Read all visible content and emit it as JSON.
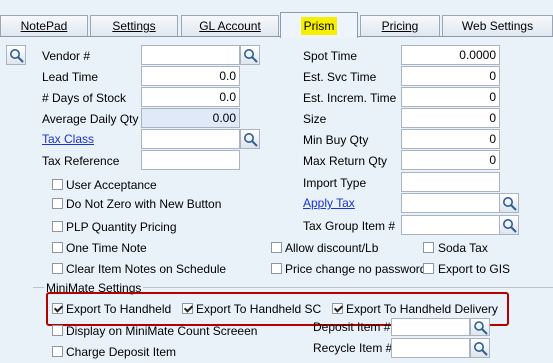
{
  "tabs": [
    {
      "label": "NotePad"
    },
    {
      "label": "Settings"
    },
    {
      "label": "GL Account"
    },
    {
      "label": "Prism"
    },
    {
      "label": "Pricing"
    },
    {
      "label": "Web Settings"
    }
  ],
  "fields_left": {
    "vendor": {
      "label": "Vendor #",
      "value": ""
    },
    "lead_time": {
      "label": "Lead Time",
      "value": "0.0"
    },
    "days_of_stock": {
      "label": "# Days of Stock",
      "value": "0.0"
    },
    "avg_daily_qty": {
      "label": "Average Daily Qty",
      "value": "0.00"
    },
    "tax_class": {
      "label": "Tax Class",
      "value": ""
    },
    "tax_reference": {
      "label": "Tax Reference",
      "value": ""
    }
  },
  "fields_right": {
    "spot_time": {
      "label": "Spot Time",
      "value": "0.0000"
    },
    "est_svc_time": {
      "label": "Est. Svc Time",
      "value": "0"
    },
    "est_increm_time": {
      "label": "Est. Increm. Time",
      "value": "0"
    },
    "size": {
      "label": "Size",
      "value": "0"
    },
    "min_buy_qty": {
      "label": "Min Buy Qty",
      "value": "0"
    },
    "max_return_qty": {
      "label": "Max Return Qty",
      "value": "0"
    },
    "import_type": {
      "label": "Import Type",
      "value": ""
    },
    "apply_tax": {
      "label": "Apply Tax",
      "value": ""
    },
    "tax_group_item": {
      "label": "Tax Group Item #",
      "value": ""
    },
    "deposit_item": {
      "label": "Deposit Item #",
      "value": ""
    },
    "recycle_item": {
      "label": "Recycle Item #",
      "value": ""
    }
  },
  "checkboxes": {
    "user_acceptance": {
      "label": "User Acceptance",
      "checked": false
    },
    "do_not_zero": {
      "label": "Do Not Zero with New Button",
      "checked": false
    },
    "plp_quantity": {
      "label": "PLP Quantity Pricing",
      "checked": false
    },
    "one_time_note": {
      "label": "One Time Note",
      "checked": false
    },
    "clear_item_notes": {
      "label": "Clear Item Notes on Schedule",
      "checked": false
    },
    "allow_discount": {
      "label": "Allow discount/Lb",
      "checked": false
    },
    "price_change": {
      "label": "Price change no password",
      "checked": false
    },
    "soda_tax": {
      "label": "Soda Tax",
      "checked": false
    },
    "export_gis": {
      "label": "Export to GIS",
      "checked": false
    }
  },
  "minimate": {
    "title": "MiniMate Settings",
    "export_handheld": {
      "label": "Export To Handheld",
      "checked": true
    },
    "export_handheld_sc": {
      "label": "Export To Handheld SC",
      "checked": true
    },
    "export_handheld_delivery": {
      "label": "Export To Handheld Delivery",
      "checked": true
    },
    "display_count": {
      "label": "Display on MiniMate Count Screeen",
      "checked": false
    },
    "charge_deposit": {
      "label": "Charge Deposit Item",
      "checked": false
    }
  },
  "colors": {
    "highlight": "#f6f000",
    "callout": "#b30000",
    "link": "#1a33cc"
  }
}
